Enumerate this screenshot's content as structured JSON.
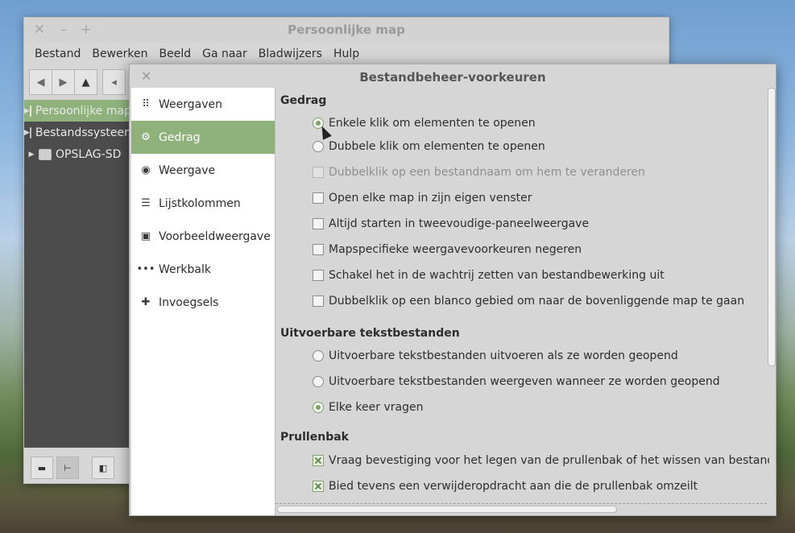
{
  "file_manager": {
    "title": "Persoonlijke map",
    "menu": [
      "Bestand",
      "Bewerken",
      "Beeld",
      "Ga naar",
      "Bladwijzers",
      "Hulp"
    ],
    "sidebar": [
      {
        "label": "Persoonlijke map",
        "selected": true
      },
      {
        "label": "Bestandssysteem",
        "selected": false
      },
      {
        "label": "OPSLAG-SD",
        "selected": false
      }
    ]
  },
  "dialog": {
    "title": "Bestandbeheer-voorkeuren",
    "nav": [
      {
        "label": "Weergaven",
        "icon": "grid-icon",
        "selected": false
      },
      {
        "label": "Gedrag",
        "icon": "gear-icon",
        "selected": true
      },
      {
        "label": "Weergave",
        "icon": "eye-icon",
        "selected": false
      },
      {
        "label": "Lijstkolommen",
        "icon": "list-icon",
        "selected": false
      },
      {
        "label": "Voorbeeldweergave",
        "icon": "image-icon",
        "selected": false
      },
      {
        "label": "Werkbalk",
        "icon": "dots-icon",
        "selected": false
      },
      {
        "label": "Invoegsels",
        "icon": "puzzle-icon",
        "selected": false
      }
    ],
    "sections": {
      "gedrag": {
        "title": "Gedrag",
        "radios": [
          {
            "label": "Enkele klik om elementen te openen",
            "checked": true
          },
          {
            "label": "Dubbele klik om elementen te openen",
            "checked": false
          }
        ],
        "checks": [
          {
            "label": "Dubbelklik op een bestandnaam om hem te veranderen",
            "checked": false,
            "disabled": true
          },
          {
            "label": "Open elke map in zijn eigen venster",
            "checked": false
          },
          {
            "label": "Altijd starten in tweevoudige-paneelweergave",
            "checked": false
          },
          {
            "label": "Mapspecifieke weergavevoorkeuren negeren",
            "checked": false
          },
          {
            "label": "Schakel het in de wachtrij zetten van bestandbewerking uit",
            "checked": false
          },
          {
            "label": "Dubbelklik op een blanco gebied om naar de bovenliggende map te gaan",
            "checked": false
          }
        ]
      },
      "uitvoerbaar": {
        "title": "Uitvoerbare tekstbestanden",
        "radios": [
          {
            "label": "Uitvoerbare tekstbestanden uitvoeren als ze worden geopend",
            "checked": false
          },
          {
            "label": "Uitvoerbare tekstbestanden weergeven wanneer ze worden geopend",
            "checked": false
          },
          {
            "label": "Elke keer vragen",
            "checked": true
          }
        ]
      },
      "prullenbak": {
        "title": "Prullenbak",
        "checks": [
          {
            "label": "Vraag bevestiging voor het legen van de prullenbak of het wissen van bestanden",
            "checked": true
          },
          {
            "label": "Bied tevens een verwijderopdracht aan die de prullenbak omzeilt",
            "checked": true
          }
        ]
      }
    }
  }
}
